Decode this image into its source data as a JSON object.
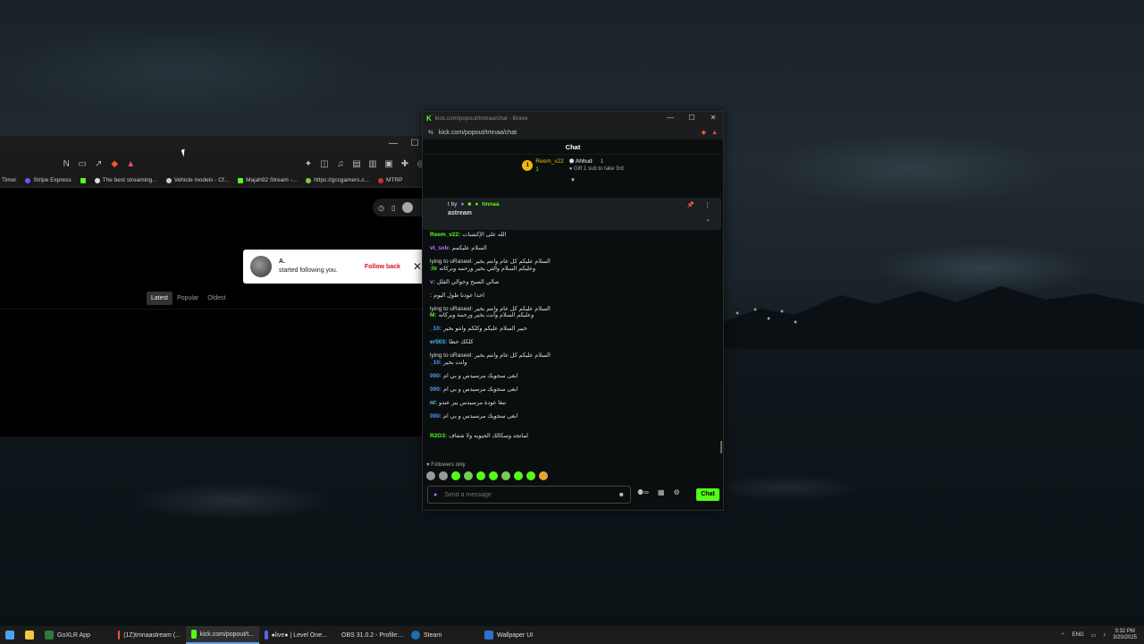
{
  "browser": {
    "bookmarks": [
      {
        "label": "Timer",
        "color": ""
      },
      {
        "label": "Stripe Express",
        "color": "#635bff"
      },
      {
        "label": "",
        "color": "#53fc18"
      },
      {
        "label": "The best streaming...",
        "color": "#ddd"
      },
      {
        "label": "Vehicle models - Cf...",
        "color": "#ccc"
      },
      {
        "label": "Majah92 Stream -...",
        "color": "#53fc18"
      },
      {
        "label": "https://gccgamers.c...",
        "color": "#8bc34a"
      },
      {
        "label": "MTRP",
        "color": "#c0392b"
      }
    ],
    "sort_tabs": [
      "Latest",
      "Popular",
      "Oldest"
    ],
    "toast": {
      "name": "A.",
      "message": "started following you.",
      "action": "Follow back",
      "close": "✕"
    }
  },
  "chat": {
    "window_title": "kick.com/popout/tmnaa/chat - Brave",
    "url": "kick.com/popout/tmnaa/chat",
    "header": "Chat",
    "leaderboard": {
      "first_rank": "1",
      "first_name": "Reem_v22",
      "first_count": "1",
      "second_name": "Ahhud",
      "second_count": "1",
      "gift_text": "Gift 1 sub to take 3rd"
    },
    "pinned": {
      "prefix": "t by",
      "user": "tmnaa",
      "text": "astream"
    },
    "messages": [
      {
        "user": "Reem_v22:",
        "color": "u-green",
        "text": "الله على الإكشنات"
      },
      {
        "user": "vt_sxb:",
        "color": "u-purple",
        "text": "السلام عليكمم"
      },
      {
        "reply": "lying to uRaseel: السلام عليكم كل عام وانتم بخير",
        "user": ":Ilr",
        "color": "u-green",
        "text": "وعليكم السلام والتي بخير ورحمه وبركاته"
      },
      {
        "user": "v:",
        "color": "u-purple",
        "text": "صالي الصبح وخوالي القلل"
      },
      {
        "user": ":",
        "color": "u-pink",
        "text": "احدا عودنا طول اليوم"
      },
      {
        "reply": "lying to uRaseel: السلام عليكم كل عام وانتم بخير",
        "user": "M:",
        "color": "u-green",
        "text": "وعليكم السلام وأنت بخير ورحمة وبركاته"
      },
      {
        "user": "_10:",
        "color": "u-blue",
        "text": "خبير السلام عليكم وكلكم وانتو بخير"
      },
      {
        "user": "er503:",
        "color": "u-cyan",
        "text": "كلكك حطا"
      },
      {
        "reply": "lying to uRaseel: السلام عليكم كل عام وانتم بخير",
        "user": "_10:",
        "color": "u-blue",
        "text": "وانت بخير"
      },
      {
        "user": "000:",
        "color": "u-blue",
        "text": "ابغى سجويك مرسيدس و بي ام"
      },
      {
        "user": "000:",
        "color": "u-blue",
        "text": "ابغى سجويك مرسيدس و بي ام"
      },
      {
        "user": "n/:",
        "color": "u-teal",
        "text": "تبغا عودة مرسيدس بير عندو"
      },
      {
        "user": "000:",
        "color": "u-blue",
        "text": "ابغى سجويك مرسيدس و بي ام"
      },
      {
        "user": "",
        "color": "u-green",
        "text": ""
      },
      {
        "user": "R2G3:",
        "color": "u-green",
        "text": "لماتجد وسكالك الحيويه ولا شفاف"
      }
    ],
    "followers_only": "Followers only",
    "input_placeholder": "Send a message",
    "chat_button": "Chat"
  },
  "taskbar": {
    "items": [
      {
        "label": "",
        "color": "#4aa3f0"
      },
      {
        "label": "",
        "color": "#f4c542"
      },
      {
        "label": "GoXLR App",
        "color": "#2b7c3a"
      },
      {
        "label": "(1Z)tmnaastream (...",
        "color": "#fb542b"
      },
      {
        "label": "kick.com/popout/t...",
        "color": "#53fc18"
      },
      {
        "label": "●live● | Level One...",
        "color": "#5865f2"
      },
      {
        "label": "OBS 31.0.2 - Profile:...",
        "color": "#444"
      },
      {
        "label": "Steam",
        "color": "#1b6fb3"
      },
      {
        "label": "Wallpaper UI",
        "color": "#2f6fd3"
      }
    ],
    "tray_lang": "ENG",
    "time": "3:32 PM",
    "date": "3/20/2025"
  }
}
